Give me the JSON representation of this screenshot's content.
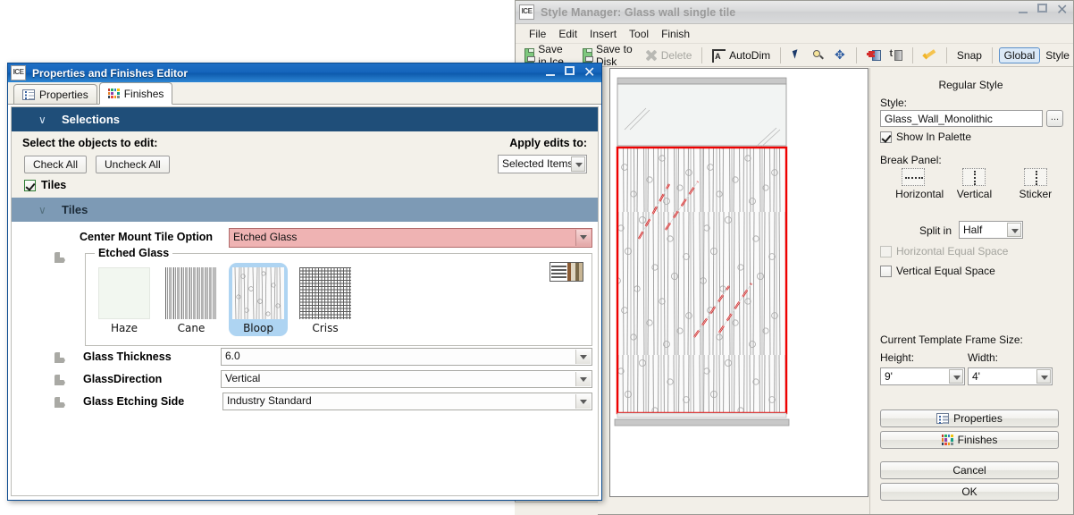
{
  "style_manager": {
    "title": "Style Manager: Glass wall single tile",
    "app_badge": "ICE",
    "window_buttons": [
      "minimize-icon",
      "maximize-icon",
      "close-icon"
    ],
    "menu": [
      "File",
      "Edit",
      "Insert",
      "Tool",
      "Finish"
    ],
    "toolbar": [
      {
        "label": "Save in Ice",
        "icon": "save-disk-icon",
        "enabled": true
      },
      {
        "label": "Save to Disk",
        "icon": "save-disk-icon",
        "enabled": true
      },
      {
        "label": "Delete",
        "icon": "delete-x-icon",
        "enabled": false
      },
      {
        "label": "AutoDim",
        "icon": "autodim-icon",
        "enabled": true
      },
      {
        "label": "",
        "icon": "select-arrow-icon",
        "enabled": true
      },
      {
        "label": "",
        "icon": "zoom-magnifier-icon",
        "enabled": true
      },
      {
        "label": "",
        "icon": "pan-move-icon",
        "enabled": true
      },
      {
        "label": "",
        "icon": "add-panel-icon",
        "enabled": true
      },
      {
        "label": "",
        "icon": "panel-tool-icon",
        "enabled": true
      },
      {
        "label": "",
        "icon": "approve-check-icon",
        "enabled": true
      },
      {
        "label": "Snap",
        "icon": "",
        "enabled": true
      },
      {
        "label": "Global",
        "icon": "",
        "enabled": true,
        "active": true
      },
      {
        "label": "Style",
        "icon": "",
        "enabled": true
      }
    ],
    "panel": {
      "heading": "Regular Style",
      "style_label": "Style:",
      "style_value": "Glass_Wall_Monolithic",
      "browse_label": "...",
      "show_in_palette": {
        "label": "Show In Palette",
        "checked": true
      },
      "break_panel_label": "Break Panel:",
      "break_panel_options": [
        {
          "label": "Horizontal",
          "icon": "break-horizontal-icon"
        },
        {
          "label": "Vertical",
          "icon": "break-vertical-icon"
        },
        {
          "label": "Sticker",
          "icon": "break-sticker-icon"
        }
      ],
      "split_in_label": "Split in",
      "split_in_value": "Half",
      "horizontal_equal_space": {
        "label": "Horizontal Equal Space",
        "checked": false,
        "enabled": false
      },
      "vertical_equal_space": {
        "label": "Vertical Equal Space",
        "checked": false,
        "enabled": true
      },
      "frame_size_label": "Current Template Frame Size:",
      "height_label": "Height:",
      "height_value": "9'",
      "width_label": "Width:",
      "width_value": "4'",
      "buttons": [
        {
          "label": "Properties",
          "icon": "properties-list-icon"
        },
        {
          "label": "Finishes",
          "icon": "finishes-swatch-icon"
        },
        {
          "label": "Cancel",
          "icon": ""
        },
        {
          "label": "OK",
          "icon": ""
        }
      ]
    },
    "canvas": {
      "selection_color": "#ee0000",
      "panel_fill": "#f4f4f4",
      "glass_texture": "bloop-etched-vertical"
    }
  },
  "editor": {
    "title": "Properties and Finishes Editor",
    "app_badge": "ICE",
    "tabs": [
      {
        "label": "Properties",
        "icon": "properties-list-icon",
        "active": false
      },
      {
        "label": "Finishes",
        "icon": "finishes-swatch-icon",
        "active": true
      }
    ],
    "selections": {
      "header": "Selections",
      "prompt": "Select the objects to edit:",
      "apply_label": "Apply edits to:",
      "apply_value": "Selected Items",
      "check_all": "Check All",
      "uncheck_all": "Uncheck All",
      "objects": [
        {
          "label": "Tiles",
          "checked": true
        }
      ]
    },
    "tiles": {
      "header": "Tiles",
      "center_mount_label": "Center Mount Tile Option",
      "center_mount_value": "Etched Glass",
      "group_title": "Etched Glass",
      "swatches": [
        {
          "name": "Haze",
          "selected": false,
          "pattern": "plain-frosted"
        },
        {
          "name": "Cane",
          "selected": false,
          "pattern": "vertical-stripes"
        },
        {
          "name": "Bloop",
          "selected": true,
          "pattern": "bloop-etched"
        },
        {
          "name": "Criss",
          "selected": false,
          "pattern": "crosshatch"
        }
      ],
      "palette_button": "palette-view-icon",
      "fields": [
        {
          "label": "Glass Thickness",
          "value": "6.0"
        },
        {
          "label": "GlassDirection",
          "value": "Vertical"
        },
        {
          "label": "Glass Etching Side",
          "value": "Industry Standard"
        }
      ]
    }
  },
  "colors": {
    "section_blue": "#1f4e79",
    "section_steel": "#7d9ab5",
    "titlebar_blue": "#1464bb",
    "pink_field": "#efb3b3",
    "selected_swatch": "#aed4f2",
    "selection_red": "#ee0000"
  }
}
